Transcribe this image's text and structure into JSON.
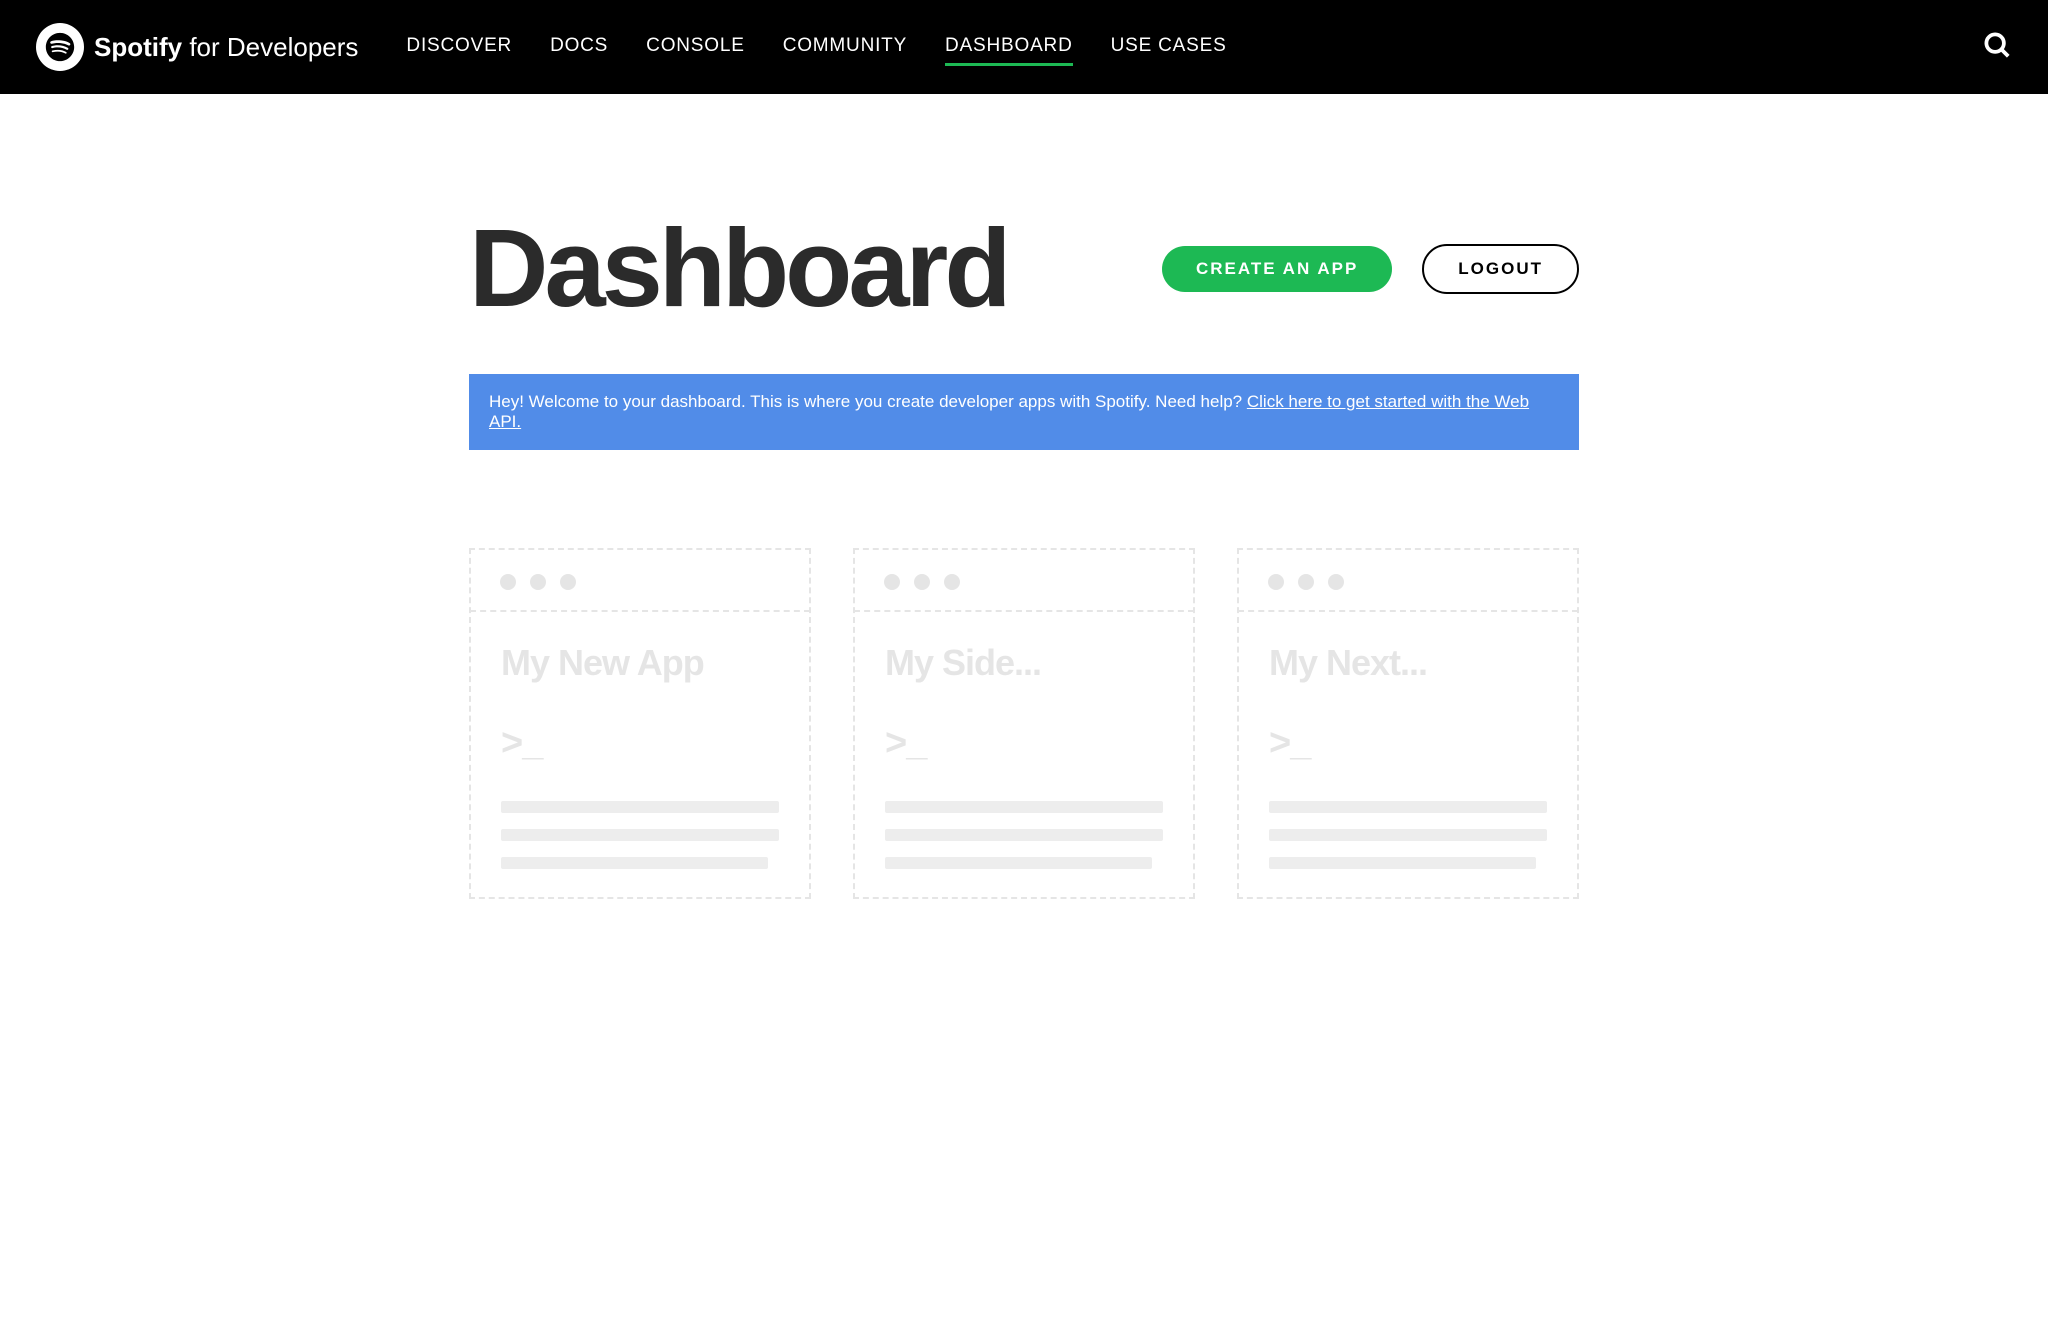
{
  "brand": {
    "name_bold": "Spotify",
    "name_light": " for Developers"
  },
  "nav": {
    "items": [
      {
        "label": "DISCOVER",
        "active": false
      },
      {
        "label": "DOCS",
        "active": false
      },
      {
        "label": "CONSOLE",
        "active": false
      },
      {
        "label": "COMMUNITY",
        "active": false
      },
      {
        "label": "DASHBOARD",
        "active": true
      },
      {
        "label": "USE CASES",
        "active": false
      }
    ]
  },
  "page": {
    "title": "Dashboard",
    "create_label": "CREATE AN APP",
    "logout_label": "LOGOUT"
  },
  "banner": {
    "text": "Hey! Welcome to your dashboard. This is where you create developer apps with Spotify. Need help? ",
    "link_text": "Click here to get started with the Web API."
  },
  "apps": [
    {
      "title": "My New App",
      "prompt": ">_"
    },
    {
      "title": "My Side...",
      "prompt": ">_"
    },
    {
      "title": "My Next...",
      "prompt": ">_"
    }
  ]
}
